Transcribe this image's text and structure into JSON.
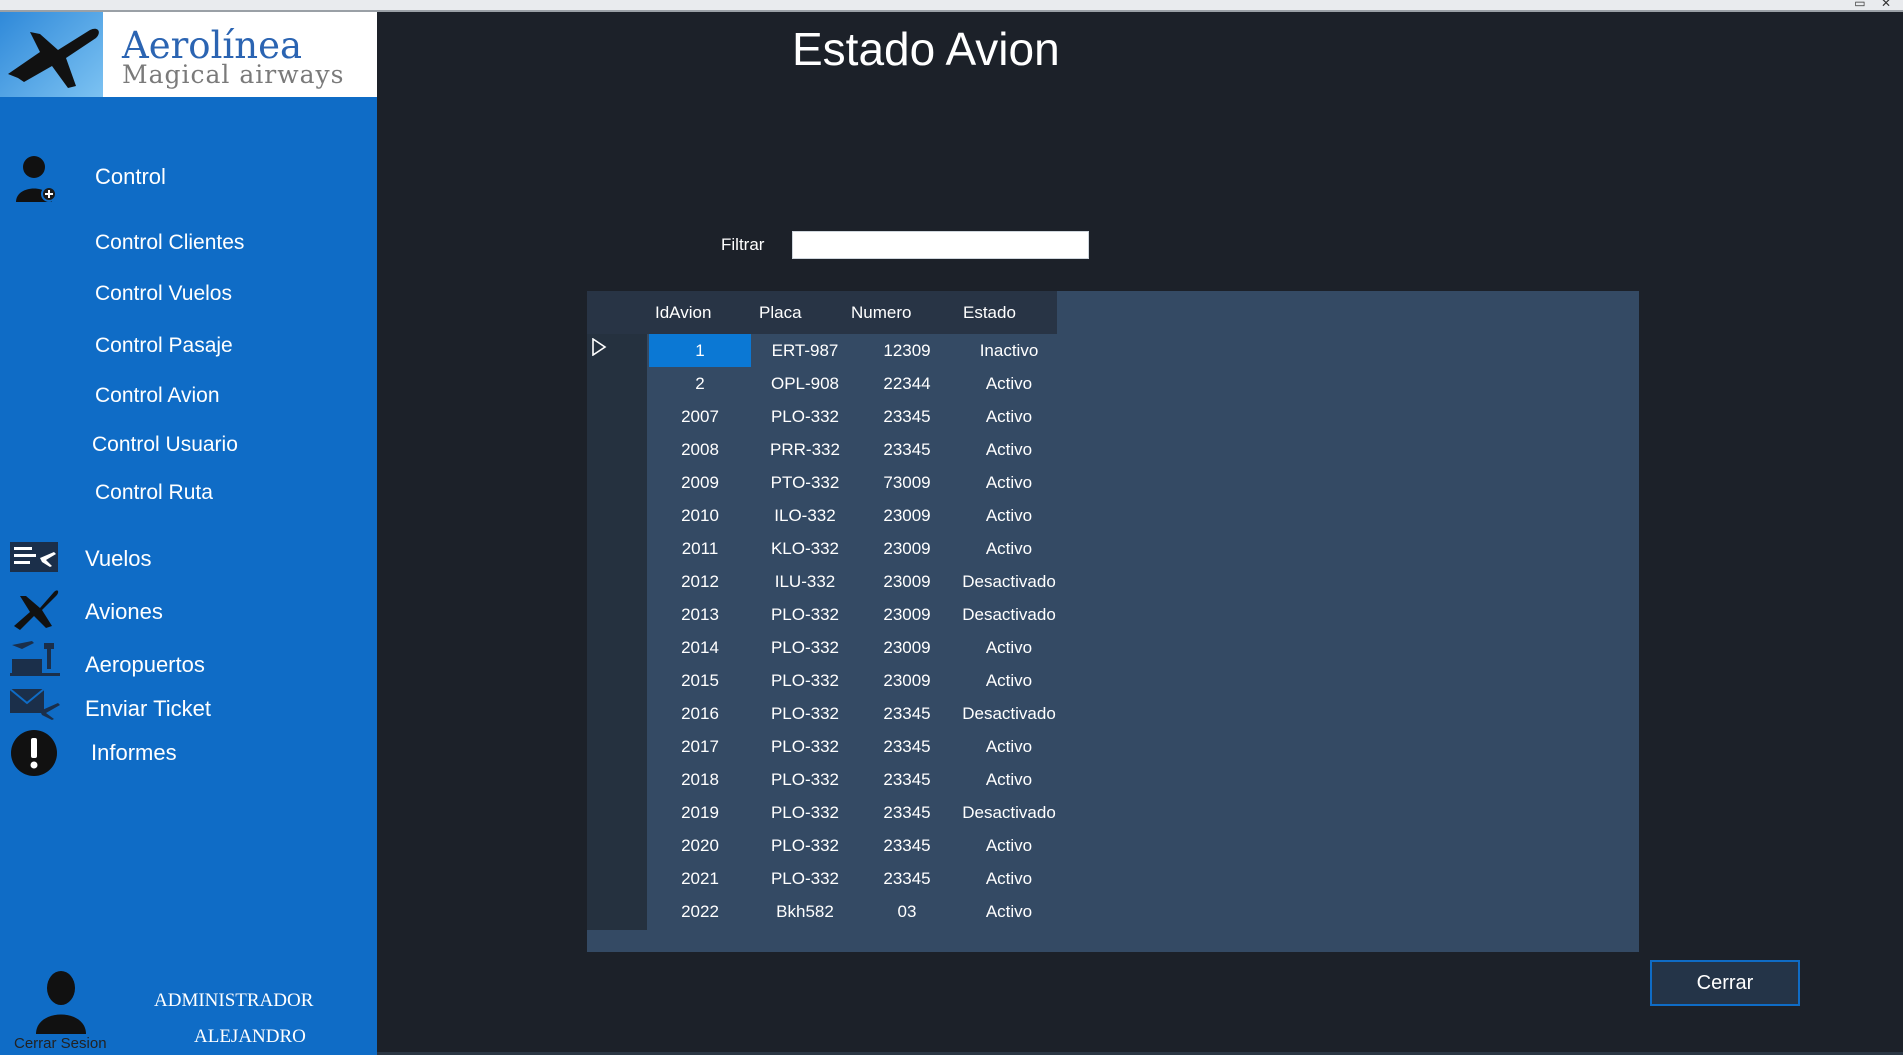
{
  "brand": {
    "title": "Aerolínea",
    "subtitle": "Magical airways"
  },
  "sidebar": {
    "control": "Control",
    "sub_items": [
      "Control Clientes",
      "Control Vuelos",
      "Control Pasaje",
      "Control Avion",
      "Control Usuario",
      "Control Ruta"
    ],
    "items": [
      {
        "label": "Vuelos",
        "icon": "flights-board-icon"
      },
      {
        "label": "Aviones",
        "icon": "airplane-icon"
      },
      {
        "label": "Aeropuertos",
        "icon": "airport-icon"
      },
      {
        "label": "Enviar Ticket",
        "icon": "send-ticket-icon"
      },
      {
        "label": "Informes",
        "icon": "alert-icon"
      }
    ],
    "user_role": "ADMINISTRADOR",
    "user_name": "ALEJANDRO",
    "logout": "Cerrar Sesion"
  },
  "page": {
    "title": "Estado Avion"
  },
  "filter": {
    "label": "Filtrar",
    "value": ""
  },
  "table": {
    "headers": [
      "IdAvion",
      "Placa",
      "Numero",
      "Estado"
    ],
    "rows": [
      [
        "1",
        "ERT-987",
        "12309",
        "Inactivo"
      ],
      [
        "2",
        "OPL-908",
        "22344",
        "Activo"
      ],
      [
        "2007",
        "PLO-332",
        "23345",
        "Activo"
      ],
      [
        "2008",
        "PRR-332",
        "23345",
        "Activo"
      ],
      [
        "2009",
        "PTO-332",
        "73009",
        "Activo"
      ],
      [
        "2010",
        "ILO-332",
        "23009",
        "Activo"
      ],
      [
        "2011",
        "KLO-332",
        "23009",
        "Activo"
      ],
      [
        "2012",
        "ILU-332",
        "23009",
        "Desactivado"
      ],
      [
        "2013",
        "PLO-332",
        "23009",
        "Desactivado"
      ],
      [
        "2014",
        "PLO-332",
        "23009",
        "Activo"
      ],
      [
        "2015",
        "PLO-332",
        "23009",
        "Activo"
      ],
      [
        "2016",
        "PLO-332",
        "23345",
        "Desactivado"
      ],
      [
        "2017",
        "PLO-332",
        "23345",
        "Activo"
      ],
      [
        "2018",
        "PLO-332",
        "23345",
        "Activo"
      ],
      [
        "2019",
        "PLO-332",
        "23345",
        "Desactivado"
      ],
      [
        "2020",
        "PLO-332",
        "23345",
        "Activo"
      ],
      [
        "2021",
        "PLO-332",
        "23345",
        "Activo"
      ],
      [
        "2022",
        "Bkh582",
        "03",
        "Activo"
      ]
    ],
    "selected_index": 0
  },
  "buttons": {
    "close": "Cerrar"
  },
  "colors": {
    "sidebar": "#0f6cc6",
    "background": "#1c2129",
    "grid": "#344a64",
    "selection": "#0b78d4"
  }
}
